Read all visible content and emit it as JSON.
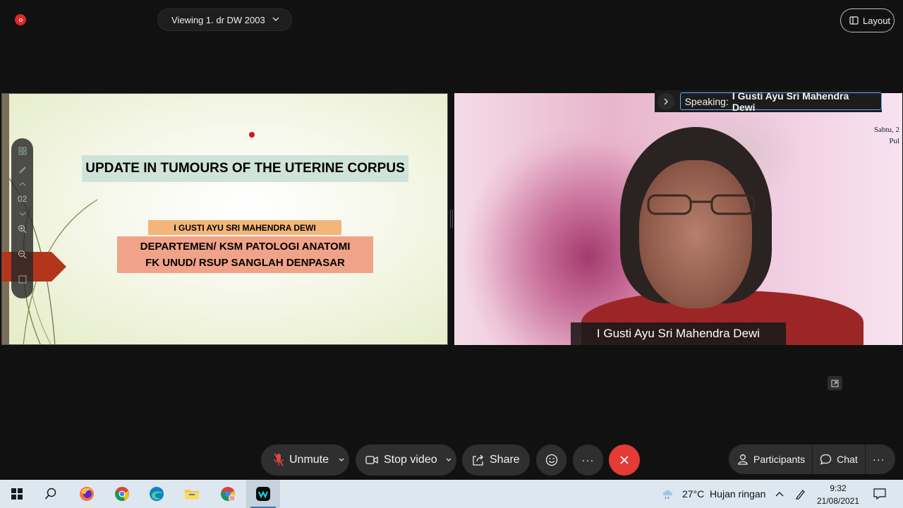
{
  "topbar": {
    "viewing_label": "Viewing 1. dr DW 2003",
    "layout_label": "Layout"
  },
  "slide": {
    "title": "UPDATE IN TUMOURS OF THE UTERINE CORPUS",
    "author": "I GUSTI AYU SRI MAHENDRA DEWI",
    "dept_line1": "DEPARTEMEN/ KSM PATOLOGI ANATOMI",
    "dept_line2": "FK UNUD/ RSUP SANGLAH DENPASAR",
    "page_number": "02"
  },
  "video": {
    "speaking_prefix": "Speaking:",
    "speaking_name": "I Gusti Ayu Sri Mahendra Dewi",
    "name_tag": "I Gusti Ayu Sri Mahendra Dewi",
    "background_text_line1": "Sabtu, 2",
    "background_text_line2": "Pul"
  },
  "toolbar": {
    "unmute_label": "Unmute",
    "stop_video_label": "Stop video",
    "share_label": "Share",
    "more_label": "···",
    "participants_label": "Participants",
    "chat_label": "Chat"
  },
  "taskbar": {
    "weather": "27°C  Hujan ringan",
    "time": "9:32",
    "date": "21/08/2021"
  },
  "colors": {
    "end_call": "#e43b36",
    "record": "#e02828",
    "speaking_border": "#5fa9ff"
  }
}
